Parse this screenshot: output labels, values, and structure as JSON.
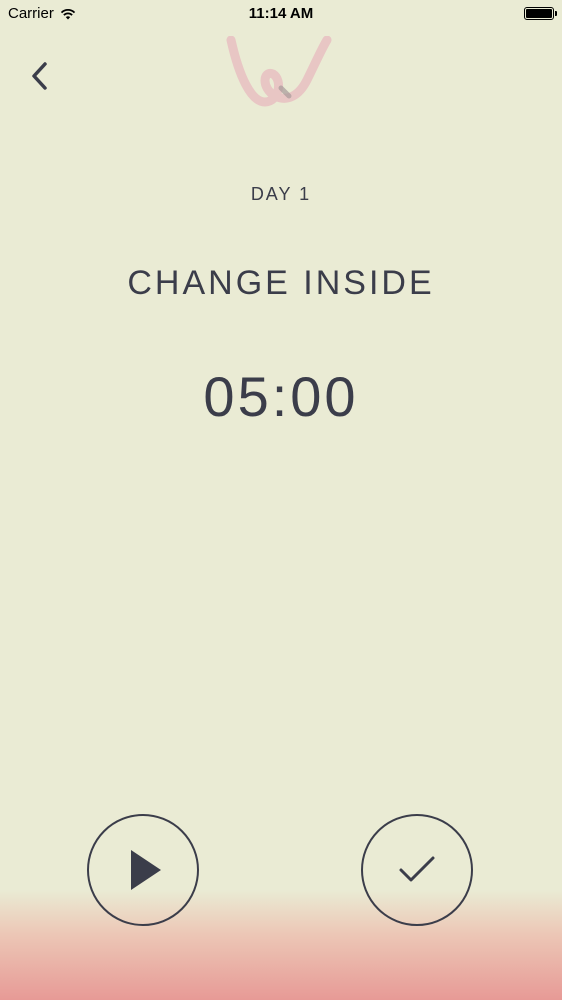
{
  "status_bar": {
    "carrier": "Carrier",
    "time": "11:14 AM",
    "battery_level": 1.0
  },
  "nav": {
    "back_icon": "chevron-left-icon",
    "logo_icon": "w-logo-icon"
  },
  "main": {
    "day_label": "DAY 1",
    "title": "CHANGE INSIDE",
    "timer": "05:00"
  },
  "controls": {
    "play_icon": "play-icon",
    "done_icon": "checkmark-icon"
  },
  "colors": {
    "background": "#eaebd4",
    "text": "#3b3d4a",
    "logo": "#e8c6c4",
    "gradient_bottom": "#e79a96"
  }
}
